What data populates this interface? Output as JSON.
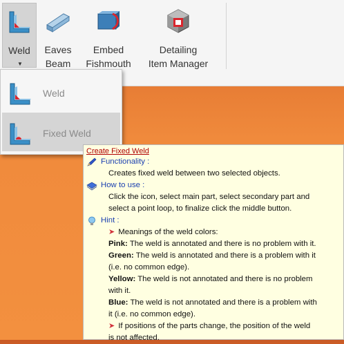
{
  "ribbon": {
    "buttons": [
      {
        "label": "Weld",
        "icon": "weld-icon"
      },
      {
        "label": "Eaves\nBeam",
        "icon": "eaves-beam-icon"
      },
      {
        "label": "Embed\nFishmouth",
        "icon": "embed-fishmouth-icon"
      },
      {
        "label": "Detailing\nItem Manager",
        "icon": "detailing-item-manager-icon"
      }
    ],
    "weld_line1": "Weld",
    "eaves_line1": "Eaves",
    "eaves_line2": "Beam",
    "embed_line1": "Embed",
    "embed_line2": "Fishmouth",
    "detail_line1": "Detailing",
    "detail_line2": "Item Manager"
  },
  "dropdown": {
    "items": [
      {
        "label": "Weld",
        "icon": "weld-icon"
      },
      {
        "label": "Fixed Weld",
        "icon": "fixed-weld-icon"
      }
    ]
  },
  "tooltip": {
    "title": "Create Fixed Weld",
    "functionality_heading": "Functionality :",
    "functionality_text": "Creates fixed weld between two selected objects.",
    "howto_heading": "How to use :",
    "howto_line1": "Click the icon, select main part, select secondary part and",
    "howto_line2": "select a point loop, to finalize click the middle button.",
    "hint_heading": "Hint :",
    "hint_meanings": "Meanings of the weld colors:",
    "pink_key": "Pink:",
    "pink_text": "The weld is annotated and there is no problem with it.",
    "green_key": "Green:",
    "green_text_line1": "The weld is annotated and there is a problem with it",
    "green_text_line2": "(i.e. no common edge).",
    "yellow_key": "Yellow:",
    "yellow_text_line1": "The weld is not annotated and there is no problem",
    "yellow_text_line2": "with it.",
    "blue_key": "Blue:",
    "blue_text_line1": "The weld is not annotated and there is a problem with",
    "blue_text_line2": "it (i.e. no common edge).",
    "hint_positions_line1": "If positions of the parts change, the position of the weld",
    "hint_positions_line2": "is not affected."
  },
  "colors": {
    "accent_red": "#b00000",
    "heading_blue": "#1a3fb0",
    "tooltip_bg": "#ffffe1"
  }
}
